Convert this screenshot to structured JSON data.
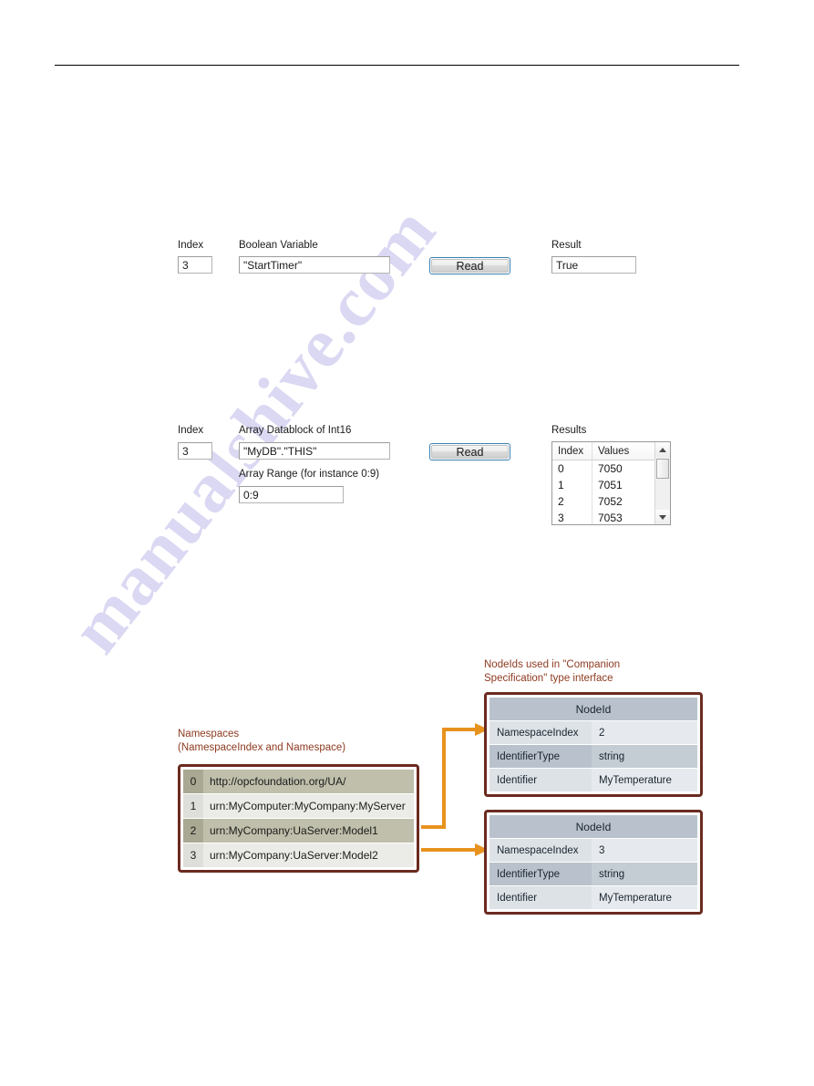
{
  "page": {
    "watermark_text": "manualshive.com",
    "accent_brown": "#6b2b20",
    "accent_orange": "#e8921e",
    "caption_color": "#8e3a20"
  },
  "boolean_section": {
    "index_label": "Index",
    "index_value": "3",
    "variable_label": "Boolean Variable",
    "variable_value": "\"StartTimer\"",
    "read_label": "Read",
    "result_label": "Result",
    "result_value": "True"
  },
  "array_section": {
    "index_label": "Index",
    "index_value": "3",
    "datablock_label": "Array Datablock of Int16",
    "datablock_value": "\"MyDB\".\"THIS\"",
    "range_label": "Array Range (for instance 0:9)",
    "range_value": "0:9",
    "read_label": "Read",
    "results_label": "Results",
    "results_table": {
      "columns": [
        "Index",
        "Values"
      ],
      "rows": [
        [
          "0",
          "7050"
        ],
        [
          "1",
          "7051"
        ],
        [
          "2",
          "7052"
        ],
        [
          "3",
          "7053"
        ]
      ]
    }
  },
  "diagram": {
    "namespaces_caption_line1": "Namespaces",
    "namespaces_caption_line2": "(NamespaceIndex and Namespace)",
    "namespaces": [
      {
        "index": "0",
        "value": "http://opcfoundation.org/UA/"
      },
      {
        "index": "1",
        "value": "urn:MyComputer:MyCompany:MyServer"
      },
      {
        "index": "2",
        "value": "urn:MyCompany:UaServer:Model1"
      },
      {
        "index": "3",
        "value": "urn:MyCompany:UaServer:Model2"
      }
    ],
    "nodeid_caption_line1": "NodeIds used in \"Companion",
    "nodeid_caption_line2": "Specification\" type interface",
    "nodeid_tables": [
      {
        "title": "NodeId",
        "rows": [
          {
            "key": "NamespaceIndex",
            "value": "2"
          },
          {
            "key": "IdentifierType",
            "value": "string"
          },
          {
            "key": "Identifier",
            "value": "MyTemperature"
          }
        ]
      },
      {
        "title": "NodeId",
        "rows": [
          {
            "key": "NamespaceIndex",
            "value": "3"
          },
          {
            "key": "IdentifierType",
            "value": "string"
          },
          {
            "key": "Identifier",
            "value": "MyTemperature"
          }
        ]
      }
    ]
  }
}
